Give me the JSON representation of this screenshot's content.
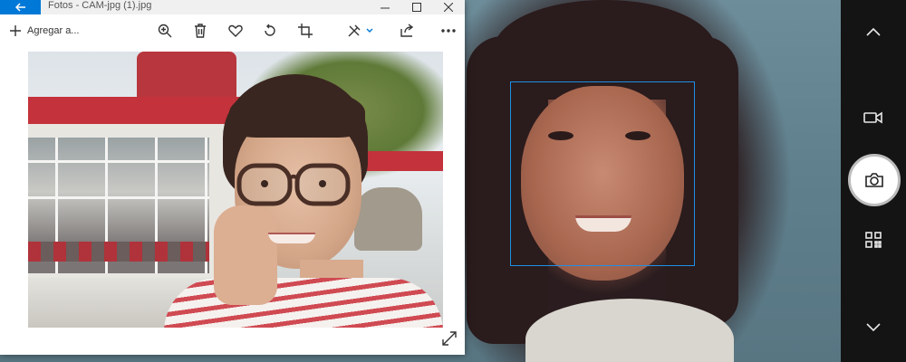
{
  "photos_window": {
    "title": "Fotos - CAM-jpg (1).jpg",
    "add_to_label": "Agregar a...",
    "back_icon": "arrow-left-icon",
    "toolbar_icons": [
      "zoom-in-icon",
      "delete-icon",
      "favorite-icon",
      "rotate-icon",
      "crop-icon",
      "edit-icon",
      "share-icon",
      "more-icon"
    ],
    "accent_color": "#0078d7"
  },
  "camera": {
    "face_box_color": "#1e90e6",
    "controls": [
      "chevron-up-icon",
      "video-icon",
      "camera-icon",
      "qr-code-icon",
      "chevron-down-icon"
    ]
  }
}
